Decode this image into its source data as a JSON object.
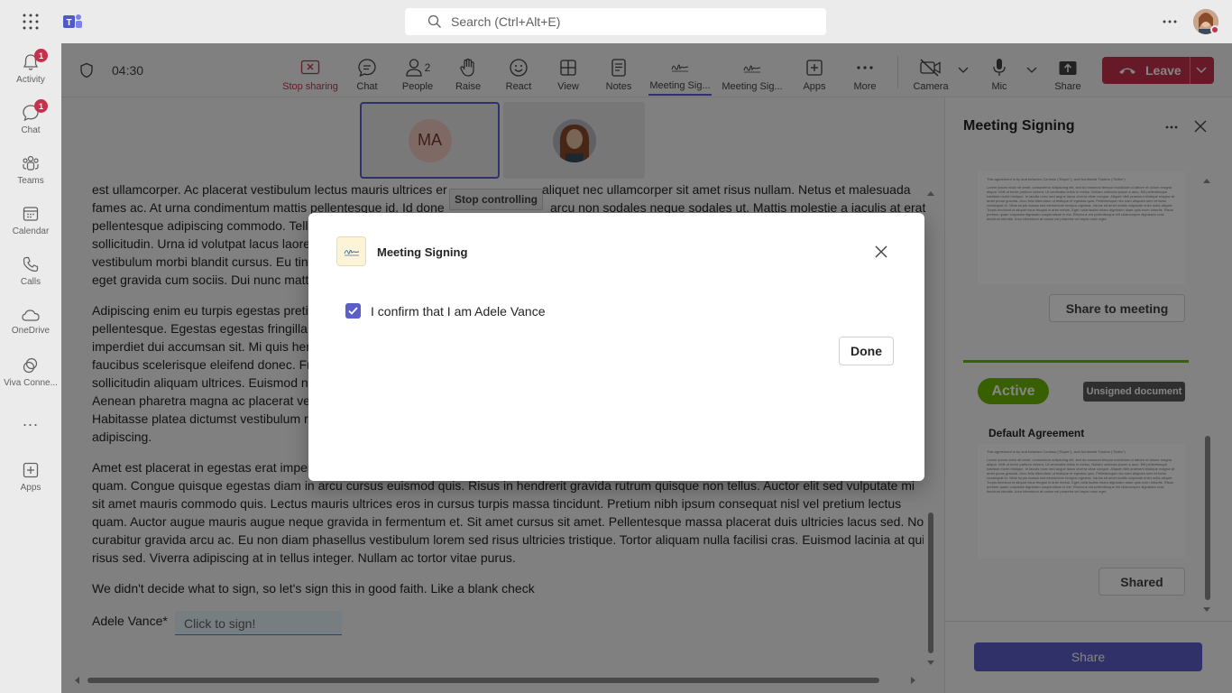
{
  "search": {
    "placeholder": "Search (Ctrl+Alt+E)"
  },
  "rail": {
    "items": [
      {
        "label": "Activity",
        "badge": "1"
      },
      {
        "label": "Chat",
        "badge": "1"
      },
      {
        "label": "Teams"
      },
      {
        "label": "Calendar"
      },
      {
        "label": "Calls"
      },
      {
        "label": "OneDrive"
      },
      {
        "label": "Viva Conne..."
      },
      {
        "label": "..."
      },
      {
        "label": "Apps"
      }
    ]
  },
  "meeting": {
    "timer": "04:30",
    "people_count": "2",
    "toolbar": [
      {
        "label": "Stop sharing",
        "icon": "stop-sharing-icon"
      },
      {
        "label": "Chat",
        "icon": "chat-icon"
      },
      {
        "label": "People",
        "icon": "people-icon"
      },
      {
        "label": "Raise",
        "icon": "hand-icon"
      },
      {
        "label": "React",
        "icon": "smile-icon"
      },
      {
        "label": "View",
        "icon": "grid-icon"
      },
      {
        "label": "Notes",
        "icon": "notes-icon"
      },
      {
        "label": "Meeting Sig...",
        "icon": "signature-icon"
      },
      {
        "label": "Meeting Sig...",
        "icon": "signature-icon"
      },
      {
        "label": "Apps",
        "icon": "apps-icon"
      },
      {
        "label": "More",
        "icon": "more-icon"
      },
      {
        "label": "Camera",
        "icon": "camera-off-icon"
      },
      {
        "label": "Mic",
        "icon": "mic-icon"
      },
      {
        "label": "Share",
        "icon": "share-icon"
      }
    ],
    "leave_label": "Leave",
    "participants": [
      {
        "initials": "MA"
      },
      {
        "initials": ""
      }
    ],
    "stop_controlling": "Stop controlling"
  },
  "document": {
    "paragraphs": [
      [
        "est ullamcorper. Ac placerat vestibulum lectus mauris ultrices er",
        "aliquet nec ullamcorper sit amet risus nullam. Netus et malesuada",
        "fames ac. At urna condimentum mattis pellentesque id. Id done",
        "arcu non sodales neque sodales ut. Mattis molestie a iaculis at erat",
        "pellentesque adipiscing commodo. Tell",
        "sollicitudin. Urna id volutpat lacus laore",
        "vestibulum morbi blandit cursus. Eu tin",
        "eget gravida cum sociis. Dui nunc matt"
      ],
      [
        "Adipiscing enim eu turpis egestas preti",
        "pellentesque. Egestas egestas fringilla p",
        "imperdiet dui accumsan sit. Mi quis her",
        "faucibus scelerisque eleifend donec. Fri",
        "sollicitudin aliquam ultrices. Euismod n",
        "Aenean pharetra magna ac placerat ves",
        "Habitasse platea dictumst vestibulum r",
        "adipiscing."
      ],
      [
        "Amet est placerat in egestas erat imper",
        "quam. Congue quisque egestas diam in arcu cursus euismod quis. Risus in hendrerit gravida rutrum quisque non tellus. Auctor elit sed vulputate mi",
        "sit amet mauris commodo quis. Lectus mauris ultrices eros in cursus turpis massa tincidunt. Pretium nibh ipsum consequat nisl vel pretium lectus",
        "quam. Auctor augue mauris augue neque gravida in fermentum et. Sit amet cursus sit amet. Pellentesque massa placerat duis ultricies lacus sed. Non",
        "curabitur gravida arcu ac. Eu non diam phasellus vestibulum lorem sed risus ultricies tristique. Tortor aliquam nulla facilisi cras. Euismod lacinia at quis",
        "risus sed. Viverra adipiscing at in tellus integer. Nullam ac tortor vitae purus."
      ]
    ],
    "closing": "We didn't decide what to sign, so let's sign this in good faith. Like a blank check",
    "signer_label": "Adele Vance*",
    "sign_placeholder": "Click to sign!"
  },
  "dialog": {
    "title": "Meeting Signing",
    "checkbox_label": "I confirm that I am Adele Vance",
    "checkbox_checked": true,
    "done_label": "Done"
  },
  "panel": {
    "title": "Meeting Signing",
    "share_to_meeting": "Share to meeting",
    "status": "Active",
    "doc_state": "Unsigned document",
    "doc_title": "Default Agreement",
    "shared_label": "Shared",
    "share_button": "Share",
    "thumb_heading": "This agreement is by and between Contoso (\"Buyer\"), and Northwind Traders (\"Seller\").",
    "thumb_body": "Lorem ipsum dolor sit amet, consectetur adipiscing elit, sed do eiusmod tempor incididunt ut labore et dolore magna aliqua. Velit ut tortor pretium viverra. Ut venenatis tellus in metus. Nullam vehicula ipsum a arcu. Elit pellentesque habitant morbi tristique. In iaculis nunc sed augue lacus viverra vitae congue. Aliquet nibh praesent tristique magna sit amet purus gravida. Arcu felis bibendum ut tristique et egestas quis. Pellentesque nec nam aliquam sem et tortor consequat id. Vitae turpis massa sed elementum tempus egestas. Varius sit amet mattis vulputate enim nulla aliquet. Turpis tincidunt id aliquet risus feugiat in ante metus. Eget nulla facilisi etiam dignissim diam quis enim lobortis. Risus pretium quam vulputate dignissim suspendisse in est. Rhoncus est pellentesque elit ullamcorper dignissim cras tincidunt lobortis. Arcu bibendum at varius vel pharetra vel turpis nunc eget."
  },
  "colors": {
    "accent": "#6264a7",
    "leave": "#c4314b",
    "active_green": "#6bb700",
    "checkbox": "#5b5fc7"
  }
}
